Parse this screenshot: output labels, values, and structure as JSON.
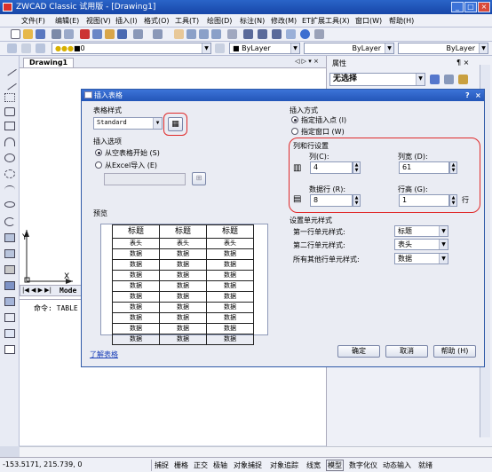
{
  "window": {
    "title": "ZWCAD Classic 试用版 - [Drawing1]",
    "min_label": "_",
    "max_label": "□",
    "close_label": "×"
  },
  "menu": [
    "文件(F)",
    "编辑(E)",
    "视图(V)",
    "插入(I)",
    "格式(O)",
    "工具(T)",
    "绘图(D)",
    "标注(N)",
    "修改(M)",
    "ET扩展工具(X)",
    "窗口(W)",
    "帮助(H)"
  ],
  "toolbar": {
    "layer_value": "0",
    "color_value": "ByLayer",
    "linetype_value": "ByLayer",
    "lineweight_value": "ByLayer"
  },
  "drawing_tab": {
    "label": "Drawing1"
  },
  "properties": {
    "title": "属性",
    "selection": "无选择"
  },
  "canvas": {
    "axis_y": "Y",
    "axis_x": "X",
    "model_tab": "Mode"
  },
  "command": {
    "prompt": "命令: TABLE"
  },
  "dialog": {
    "title": "插入表格",
    "help_mark": "?",
    "close_label": "×",
    "table_style_group": "表格样式",
    "table_style_value": "Standard",
    "insert_options_group": "插入选项",
    "opt_empty": "从空表格开始 (S)",
    "opt_excel": "从Excel导入 (E)",
    "preview_group": "预览",
    "preview": {
      "header": [
        "标题",
        "标题",
        "标题"
      ],
      "subheader": [
        "表头",
        "表头",
        "表头"
      ],
      "rows": [
        [
          "数据",
          "数据",
          "数据"
        ],
        [
          "数据",
          "数据",
          "数据"
        ],
        [
          "数据",
          "数据",
          "数据"
        ],
        [
          "数据",
          "数据",
          "数据"
        ],
        [
          "数据",
          "数据",
          "数据"
        ],
        [
          "数据",
          "数据",
          "数据"
        ],
        [
          "数据",
          "数据",
          "数据"
        ],
        [
          "数据",
          "数据",
          "数据"
        ],
        [
          "数据",
          "数据",
          "数据"
        ]
      ]
    },
    "insert_mode_group": "插入方式",
    "mode_point": "指定插入点 (I)",
    "mode_window": "指定窗口 (W)",
    "col_row_group": "列和行设置",
    "columns_label": "列(C):",
    "columns_value": "4",
    "col_width_label": "列宽 (D):",
    "col_width_value": "61",
    "data_rows_label": "数据行 (R):",
    "data_rows_value": "8",
    "row_height_label": "行高 (G):",
    "row_height_value": "1",
    "row_unit": "行",
    "cell_style_group": "设置单元样式",
    "first_row_label": "第一行单元样式:",
    "first_row_value": "标题",
    "second_row_label": "第二行单元样式:",
    "second_row_value": "表头",
    "other_rows_label": "所有其他行单元样式:",
    "other_rows_value": "数据",
    "learn_link": "了解表格",
    "ok_label": "确定",
    "cancel_label": "取消",
    "help_label": "帮助 (H)"
  },
  "status": {
    "coords": "-153.5171,  215.739,  0",
    "items": [
      "捕捉",
      "栅格",
      "正交",
      "极轴",
      "对象捕捉",
      "对象追踪",
      "线宽",
      "模型",
      "数字化仪",
      "动态输入",
      "就绪"
    ]
  },
  "colors": {
    "accent": "#2356b8",
    "highlight_red": "#e02a2a"
  }
}
